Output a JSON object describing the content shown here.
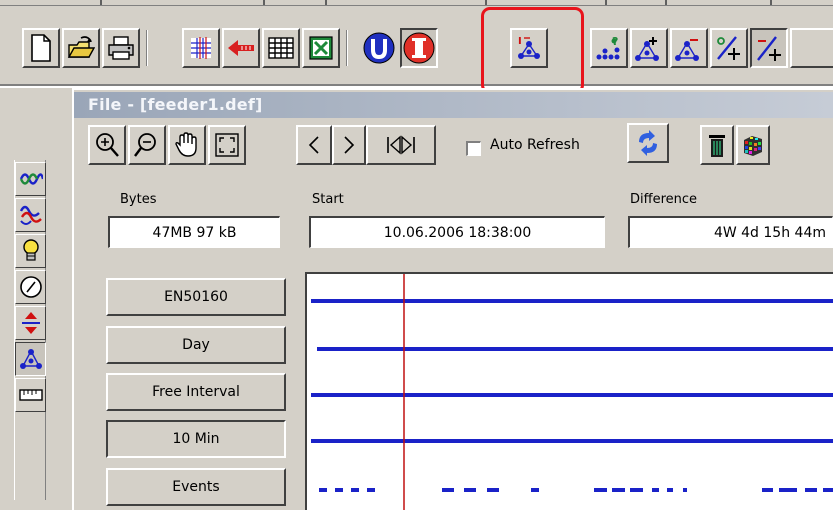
{
  "toolbar": {
    "buttons": [
      {
        "icon": "new-document-icon"
      },
      {
        "icon": "open-folder-icon"
      },
      {
        "icon": "print-icon"
      },
      {
        "icon": "grid-table-icon"
      },
      {
        "icon": "back-arrow-icon"
      },
      {
        "icon": "list-view-icon"
      },
      {
        "icon": "excel-export-icon"
      },
      {
        "icon": "voltage-u-icon",
        "label": "U"
      },
      {
        "icon": "current-i-icon",
        "label": "I"
      },
      {
        "icon": "phase-diagram-icon"
      },
      {
        "icon": "harmonics-icon"
      },
      {
        "icon": "add-triangle-icon"
      },
      {
        "icon": "remove-triangle-icon"
      },
      {
        "icon": "percent-add-icon"
      },
      {
        "icon": "slash-add-icon"
      }
    ],
    "highlight_color": "#e8141c"
  },
  "sidebar": {
    "buttons": [
      {
        "icon": "waveform-icon"
      },
      {
        "icon": "three-phase-waveform-icon"
      },
      {
        "icon": "lightbulb-icon"
      },
      {
        "icon": "gauge-icon"
      },
      {
        "icon": "red-arrows-icon"
      },
      {
        "icon": "triangle-network-icon"
      },
      {
        "icon": "ruler-icon"
      }
    ]
  },
  "window": {
    "title": "File - [feeder1.def]",
    "tools": [
      {
        "icon": "zoom-in-icon"
      },
      {
        "icon": "zoom-out-icon"
      },
      {
        "icon": "pan-hand-icon"
      },
      {
        "icon": "fit-view-icon"
      },
      {
        "icon": "previous-icon"
      },
      {
        "icon": "next-icon"
      },
      {
        "icon": "first-last-icon"
      },
      {
        "icon": "refresh-icon"
      },
      {
        "icon": "delete-icon"
      },
      {
        "icon": "color-cube-icon"
      }
    ],
    "auto_refresh": {
      "label": "Auto Refresh",
      "checked": false
    },
    "bytes": {
      "label": "Bytes",
      "value": "47MB 97 kB"
    },
    "start": {
      "label": "Start",
      "value": "10.06.2006  18:38:00"
    },
    "difference": {
      "label": "Difference",
      "value": "4W 4d 15h 44m"
    },
    "mode_buttons": [
      {
        "label": "EN50160",
        "pressed": false
      },
      {
        "label": "Day",
        "pressed": false
      },
      {
        "label": "Free Interval",
        "pressed": false
      },
      {
        "label": "10 Min",
        "pressed": true
      },
      {
        "label": "Events",
        "pressed": false
      }
    ]
  },
  "colors": {
    "face": "#d4d0c8",
    "plot_line": "#1a22c8",
    "cursor": "#c01010"
  }
}
